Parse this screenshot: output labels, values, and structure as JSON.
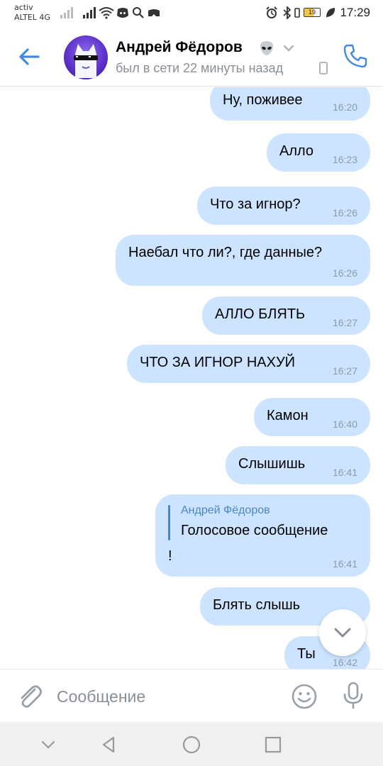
{
  "status_bar": {
    "carrier_top": "activ",
    "carrier_bottom": "ALTEL 4G",
    "battery": "19",
    "time": "17:29",
    "icons": [
      "signal-icon",
      "signal-icon",
      "wifi-icon",
      "discord-icon",
      "search-icon",
      "game-icon",
      "alarm-icon",
      "bluetooth-icon",
      "battery-icon",
      "leaf-icon"
    ]
  },
  "header": {
    "contact_name": "Андрей Фёдоров",
    "status": "был в сети 22 минуты назад",
    "icons": [
      "back-arrow-icon",
      "avatar",
      "alien-icon",
      "chevron-down-icon",
      "phone-icon",
      "call-icon"
    ]
  },
  "messages": [
    {
      "text": "Ну, поживее",
      "time": "16:20"
    },
    {
      "text": "Алло",
      "time": "16:23"
    },
    {
      "text": "Что за игнор?",
      "time": "16:26"
    },
    {
      "text": "Наебал что ли?, где данные?",
      "time": "16:26"
    },
    {
      "text": "АЛЛО БЛЯТЬ",
      "time": "16:27"
    },
    {
      "text": "ЧТО ЗА ИГНОР НАХУЙ",
      "time": "16:27"
    },
    {
      "text": "Камон",
      "time": "16:40"
    },
    {
      "text": "Слышишь",
      "time": "16:41"
    },
    {
      "reply_name": "Андрей Фёдоров",
      "reply_text": "Голосовое сообщение",
      "text": "!",
      "time": "16:41"
    },
    {
      "text": "Блять слышь",
      "time": ""
    },
    {
      "text": "Ты",
      "time": "16:42"
    }
  ],
  "input": {
    "placeholder": "Сообщение",
    "icons": [
      "paperclip-icon",
      "emoji-icon",
      "microphone-icon"
    ]
  },
  "navbar": {
    "icons": [
      "chevron-down-icon",
      "back-triangle-icon",
      "home-circle-icon",
      "recents-square-icon"
    ]
  },
  "colors": {
    "bubble": "#cce4ff",
    "accent": "#4b86c6",
    "muted": "#8a8f96"
  }
}
